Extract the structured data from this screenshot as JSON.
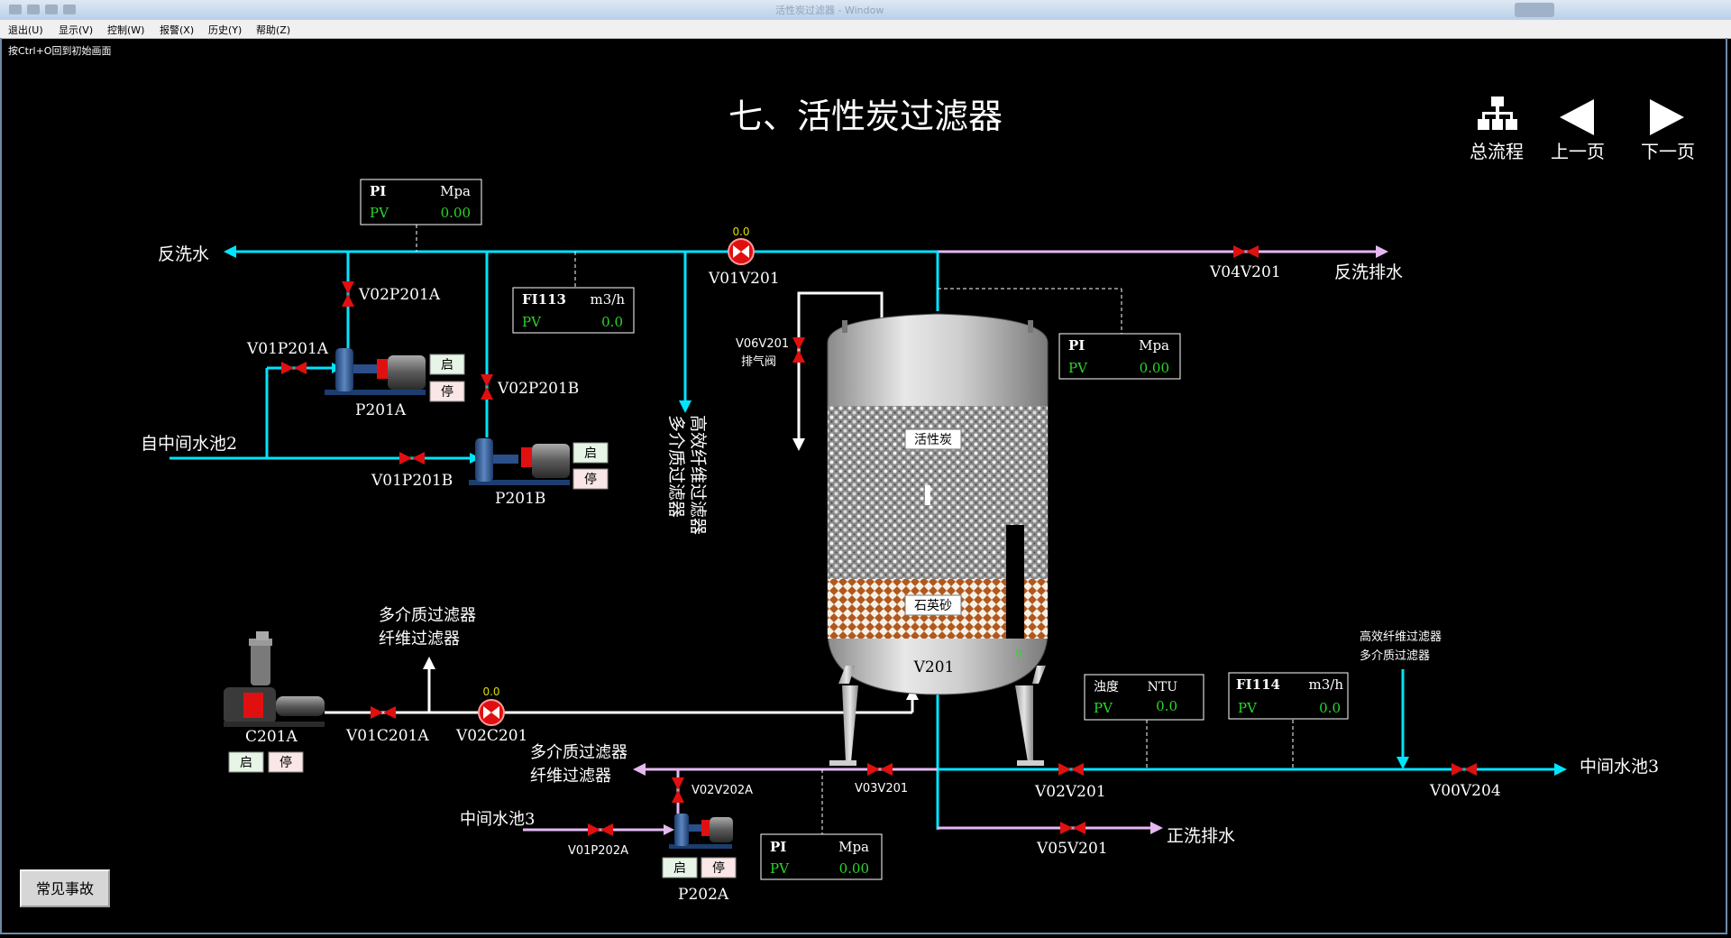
{
  "window": {
    "title": "活性炭过滤器 - Window"
  },
  "menu": [
    {
      "label": "退出(U)"
    },
    {
      "label": "显示(V)"
    },
    {
      "label": "控制(W)"
    },
    {
      "label": "报警(X)"
    },
    {
      "label": "历史(Y)"
    },
    {
      "label": "帮助(Z)"
    }
  ],
  "hint": "按Ctrl+O回到初始画面",
  "page_title": "七、活性炭过滤器",
  "nav": {
    "overview": "总流程",
    "prev": "上一页",
    "next": "下一页"
  },
  "labels": {
    "backwash_water": "反洗水",
    "backwash_drain": "反洗排水",
    "from_pool2": "自中间水池2",
    "multi_high_1": "多介质过滤器",
    "multi_high_2": "高效纤维过滤器",
    "to_multi_1": "多介质过滤器",
    "to_fiber_1": "纤维过滤器",
    "to_multi_2": "多介质过滤器",
    "to_fiber_2": "纤维过滤器",
    "pool3_in": "中间水池3",
    "pool3_out": "中间水池3",
    "rinse_drain": "正洗排水",
    "high_fiber": "高效纤维过滤器",
    "multi_media": "多介质过滤器",
    "vent_valve": "V06V201",
    "vent_valve_name": "排气阀",
    "carbon": "活性炭",
    "quartz": "石英砂",
    "tank": "V201",
    "tank_level": "0"
  },
  "equipment": {
    "P201A": "P201A",
    "P201B": "P201B",
    "P202A": "P202A",
    "C201A": "C201A"
  },
  "valves": {
    "V02P201A": "V02P201A",
    "V01P201A": "V01P201A",
    "V02P201B": "V02P201B",
    "V01P201B": "V01P201B",
    "V01V201": "V01V201",
    "V04V201": "V04V201",
    "V01C201A": "V01C201A",
    "V02C201": "V02C201",
    "V02V202A": "V02V202A",
    "V01P202A": "V01P202A",
    "V03V201": "V03V201",
    "V02V201": "V02V201",
    "V05V201": "V05V201",
    "V00V204": "V00V204"
  },
  "control_values": {
    "V01V201": "0.0",
    "V02C201": "0.0"
  },
  "buttons": {
    "start": "启",
    "stop": "停",
    "accidents": "常见事故"
  },
  "instruments": {
    "pi_top": {
      "tag": "PI",
      "unit": "Mpa",
      "pv_label": "PV",
      "value": "0.00"
    },
    "fi113": {
      "tag": "FI113",
      "unit": "m3/h",
      "pv_label": "PV",
      "value": "0.0"
    },
    "pi_tank": {
      "tag": "PI",
      "unit": "Mpa",
      "pv_label": "PV",
      "value": "0.00"
    },
    "turbidity": {
      "tag": "浊度",
      "unit": "NTU",
      "pv_label": "PV",
      "value": "0.0"
    },
    "fi114": {
      "tag": "FI114",
      "unit": "m3/h",
      "pv_label": "PV",
      "value": "0.0"
    },
    "pi_bottom": {
      "tag": "PI",
      "unit": "Mpa",
      "pv_label": "PV",
      "value": "0.00"
    }
  },
  "colors": {
    "pipe_water": "#00e5ff",
    "pipe_drain": "#e5b8f0",
    "pipe_air": "#ffffff",
    "valve": "#e01010",
    "pv_value": "#2bd62b"
  }
}
